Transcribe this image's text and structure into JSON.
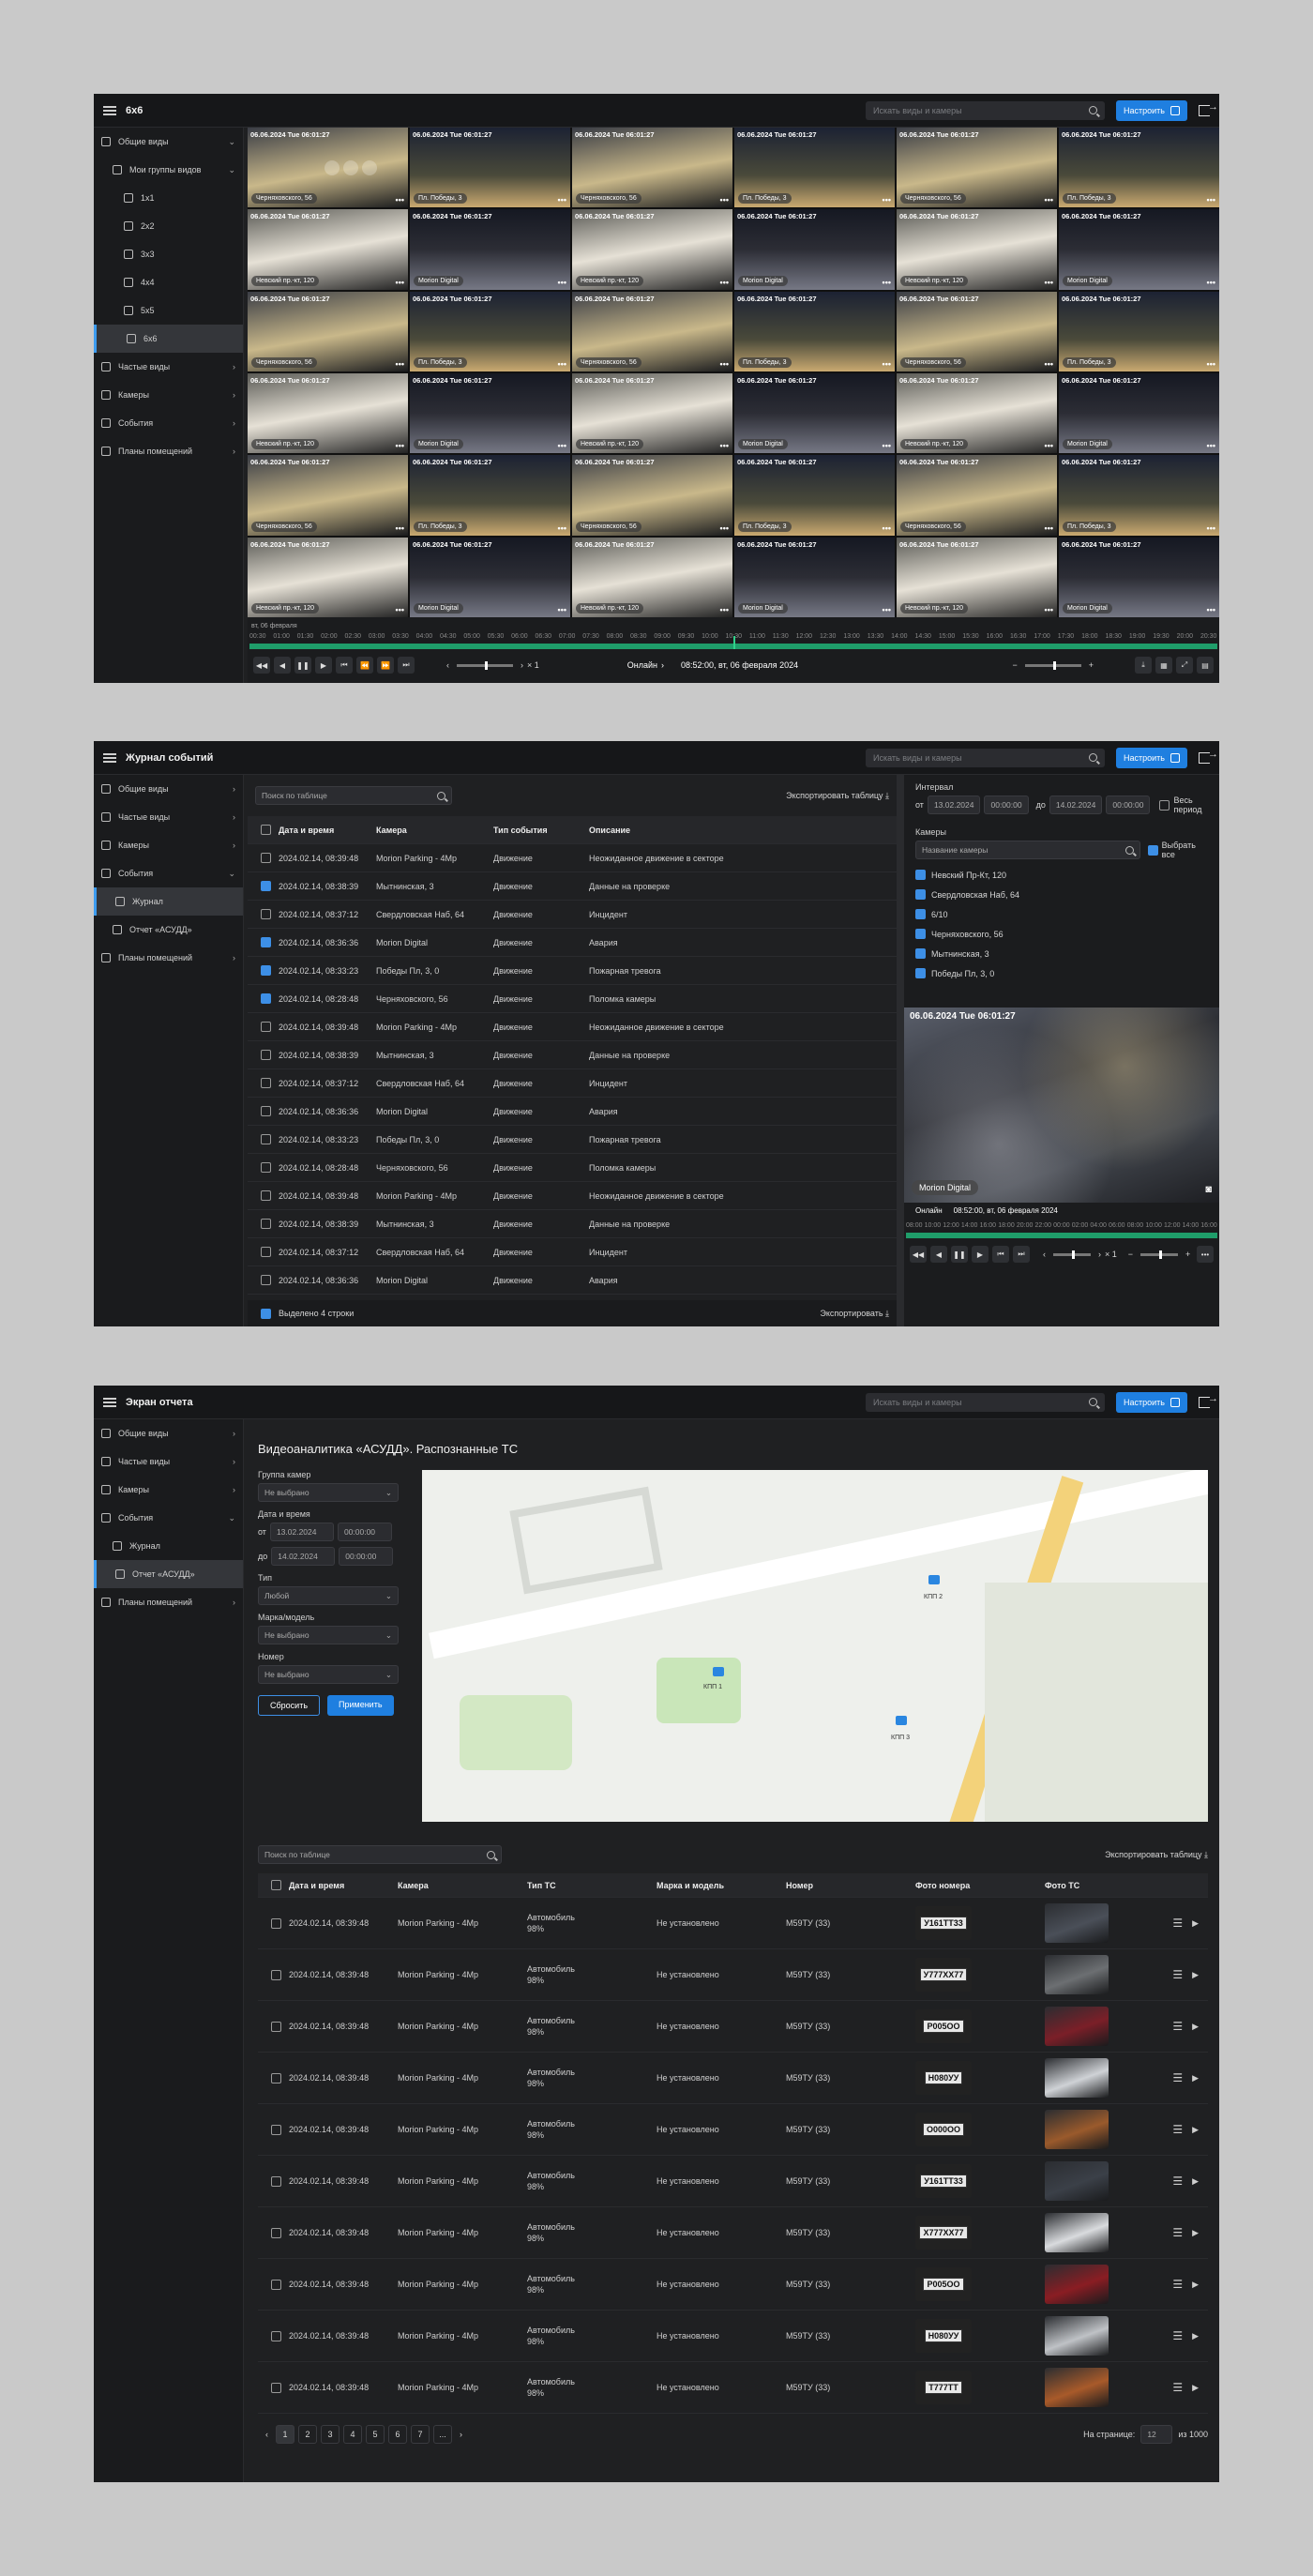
{
  "s1": {
    "title": "6x6",
    "search_placeholder": "Искать виды и камеры",
    "configure": "Настроить",
    "sidebar": [
      {
        "label": "Общие виды",
        "level": 0,
        "icon": "eye-icon",
        "chev": "⌄"
      },
      {
        "label": "Мои группы видов",
        "level": 1,
        "icon": "folder-icon",
        "chev": "⌄"
      },
      {
        "label": "1x1",
        "level": 2,
        "icon": "grid-1-icon"
      },
      {
        "label": "2x2",
        "level": 2,
        "icon": "grid-2-icon"
      },
      {
        "label": "3x3",
        "level": 2,
        "icon": "grid-3-icon"
      },
      {
        "label": "4x4",
        "level": 2,
        "icon": "grid-4-icon"
      },
      {
        "label": "5x5",
        "level": 2,
        "icon": "grid-5-icon"
      },
      {
        "label": "6x6",
        "level": 2,
        "icon": "grid-6-icon",
        "active": true
      },
      {
        "label": "Частые виды",
        "level": 0,
        "icon": "bookmark-icon",
        "chev": "›"
      },
      {
        "label": "Камеры",
        "level": 0,
        "icon": "camera-icon",
        "chev": "›"
      },
      {
        "label": "События",
        "level": 0,
        "icon": "events-icon",
        "chev": "›"
      },
      {
        "label": "Планы помещений",
        "level": 0,
        "icon": "home-icon",
        "chev": "›"
      }
    ],
    "tile_timestamp": "06.06.2024 Tue 06:01:27",
    "tile_names": [
      "Черняховскогo, 56",
      "Пл. Победы, 3",
      "Невский пр.-кт, 120",
      "Morion Digital"
    ],
    "timeline_date": "вт, 06 февраля",
    "timeline_ticks": [
      "00:30",
      "01:00",
      "01:30",
      "02:00",
      "02:30",
      "03:00",
      "03:30",
      "04:00",
      "04:30",
      "05:00",
      "05:30",
      "06:00",
      "06:30",
      "07:00",
      "07:30",
      "08:00",
      "08:30",
      "09:00",
      "09:30",
      "10:00",
      "10:30",
      "11:00",
      "11:30",
      "12:00",
      "12:30",
      "13:00",
      "13:30",
      "14:00",
      "14:30",
      "15:00",
      "15:30",
      "16:00",
      "16:30",
      "17:00",
      "17:30",
      "18:00",
      "18:30",
      "19:00",
      "19:30",
      "20:00",
      "20:30"
    ],
    "speed": "× 1",
    "online": "Онлайн",
    "datetime": "08:52:00, вт, 06 февраля 2024"
  },
  "s2": {
    "title": "Журнал событий",
    "search_placeholder": "Искать виды и камеры",
    "configure": "Настроить",
    "sidebar": [
      {
        "label": "Общие виды",
        "icon": "eye-icon",
        "chev": "›"
      },
      {
        "label": "Частые виды",
        "icon": "bookmark-icon",
        "chev": "›"
      },
      {
        "label": "Камеры",
        "icon": "camera-icon",
        "chev": "›"
      },
      {
        "label": "События",
        "icon": "events-icon",
        "chev": "⌄"
      },
      {
        "label": "Журнал",
        "icon": "list-icon",
        "sub": true,
        "active": true
      },
      {
        "label": "Отчет «АСУДД»",
        "icon": "report-icon",
        "sub": true
      },
      {
        "label": "Планы помещений",
        "icon": "home-icon",
        "chev": "›"
      }
    ],
    "table_search": "Поиск по таблице",
    "export_table": "Экспортировать таблицу",
    "columns": [
      "Дата и время",
      "Камера",
      "Тип события",
      "Описание"
    ],
    "rows": [
      [
        "2024.02.14, 08:39:48",
        "Morion Parking - 4Mp",
        "Движение",
        "Неожиданное движение в секторе",
        false
      ],
      [
        "2024.02.14, 08:38:39",
        "Мытнинская, 3",
        "Движение",
        "Данные на проверке",
        true
      ],
      [
        "2024.02.14, 08:37:12",
        "Свердловская Наб, 64",
        "Движение",
        "Инцидент",
        false
      ],
      [
        "2024.02.14, 08:36:36",
        "Morion Digital",
        "Движение",
        "Авария",
        true
      ],
      [
        "2024.02.14, 08:33:23",
        "Победы Пл, 3, 0",
        "Движение",
        "Пожарная тревога",
        true
      ],
      [
        "2024.02.14, 08:28:48",
        "Черняховского, 56",
        "Движение",
        "Поломка камеры",
        true
      ],
      [
        "2024.02.14, 08:39:48",
        "Morion Parking - 4Mp",
        "Движение",
        "Неожиданное движение в секторе",
        false
      ],
      [
        "2024.02.14, 08:38:39",
        "Мытнинская, 3",
        "Движение",
        "Данные на проверке",
        false
      ],
      [
        "2024.02.14, 08:37:12",
        "Свердловская Наб, 64",
        "Движение",
        "Инцидент",
        false
      ],
      [
        "2024.02.14, 08:36:36",
        "Morion Digital",
        "Движение",
        "Авария",
        false
      ],
      [
        "2024.02.14, 08:33:23",
        "Победы Пл, 3, 0",
        "Движение",
        "Пожарная тревога",
        false
      ],
      [
        "2024.02.14, 08:28:48",
        "Черняховского, 56",
        "Движение",
        "Поломка камеры",
        false
      ],
      [
        "2024.02.14, 08:39:48",
        "Morion Parking - 4Mp",
        "Движение",
        "Неожиданное движение в секторе",
        false
      ],
      [
        "2024.02.14, 08:38:39",
        "Мытнинская, 3",
        "Движение",
        "Данные на проверке",
        false
      ],
      [
        "2024.02.14, 08:37:12",
        "Свердловская Наб, 64",
        "Движение",
        "Инцидент",
        false
      ],
      [
        "2024.02.14, 08:36:36",
        "Morion Digital",
        "Движение",
        "Авария",
        false
      ]
    ],
    "selected": "Выделено 4 строки",
    "export": "Экспортировать",
    "interval_label": "Интервал",
    "from": "от",
    "to": "до",
    "date_from": "13.02.2024",
    "time_from": "00:00:00",
    "date_to": "14.02.2024",
    "time_to": "00:00:00",
    "whole_period": "Весь период",
    "cameras_label": "Камеры",
    "camera_search": "Название камеры",
    "select_all": "Выбрать все",
    "cameras": [
      "Невский Пр-Кт, 120",
      "Свердловская Наб, 64",
      "6/10",
      "Черняховского, 56",
      "Мытнинская, 3",
      "Победы Пл, 3, 0"
    ],
    "preview_ts": "06.06.2024 Tue 06:01:27",
    "preview_name": "Morion Digital",
    "online": "Онлайн",
    "datetime": "08:52:00, вт, 06 февраля 2024",
    "ticks": [
      "08:00",
      "10:00",
      "12:00",
      "14:00",
      "16:00",
      "18:00",
      "20:00",
      "22:00",
      "00:00",
      "02:00",
      "04:00",
      "06:00",
      "08:00",
      "10:00",
      "12:00",
      "14:00",
      "16:00"
    ],
    "speed": "× 1"
  },
  "s3": {
    "title": "Экран отчета",
    "search_placeholder": "Искать виды и камеры",
    "configure": "Настроить",
    "sidebar": [
      {
        "label": "Общие виды",
        "icon": "eye-icon",
        "chev": "›"
      },
      {
        "label": "Частые виды",
        "icon": "bookmark-icon",
        "chev": "›"
      },
      {
        "label": "Камеры",
        "icon": "camera-icon",
        "chev": "›"
      },
      {
        "label": "События",
        "icon": "events-icon",
        "chev": "⌄"
      },
      {
        "label": "Журнал",
        "icon": "list-icon",
        "sub": true
      },
      {
        "label": "Отчет «АСУДД»",
        "icon": "report-icon",
        "sub": true,
        "active": true
      },
      {
        "label": "Планы помещений",
        "icon": "home-icon",
        "chev": "›"
      }
    ],
    "heading": "Видеоаналитика «АСУДД». Распознанные ТС",
    "filters": {
      "group_label": "Группа камер",
      "group_value": "Не выбрано",
      "date_label": "Дата и время",
      "from": "от",
      "to": "до",
      "date_from": "13.02.2024",
      "time_from": "00:00:00",
      "date_to": "14.02.2024",
      "time_to": "00:00:00",
      "type_label": "Тип",
      "type_value": "Любой",
      "brand_label": "Марка/модель",
      "brand_value": "Не выбрано",
      "number_label": "Номер",
      "number_value": "Не выбрано",
      "reset": "Сбросить",
      "apply": "Применить"
    },
    "map_labels": [
      "КПП 1",
      "КПП 2",
      "КПП 3"
    ],
    "table_search": "Поиск по таблице",
    "export_table": "Экспортировать таблицу",
    "columns": [
      "Дата и время",
      "Камера",
      "Тип ТС",
      "Марка и модель",
      "Номер",
      "Фото номера",
      "Фото ТС"
    ],
    "row": {
      "dt": "2024.02.14, 08:39:48",
      "cam": "Morion Parking - 4Mp",
      "type1": "Автомобиль",
      "type2": "98%",
      "brand": "Не установлено",
      "num": "М59ТУ (33)"
    },
    "plates": [
      "У161ТТ33",
      "У777ХХ77",
      "Р005ОО",
      "Н080УУ",
      "О000ОО",
      "У161ТТ33",
      "Х777ХХ77",
      "Р005ОО",
      "Н080УУ",
      "Т777ТТ"
    ],
    "car_colors": [
      "#4a4f58",
      "#6c6f72",
      "#7b1f28",
      "#cfd2d6",
      "#9a5a2c",
      "#3b4048",
      "#d9dbde",
      "#8a1d23",
      "#bfc2c6",
      "#a85a2a"
    ],
    "pages": [
      "1",
      "2",
      "3",
      "4",
      "5",
      "6",
      "7",
      "..."
    ],
    "per_page_label": "На странице:",
    "per_page": "12",
    "of": "из 1000"
  }
}
